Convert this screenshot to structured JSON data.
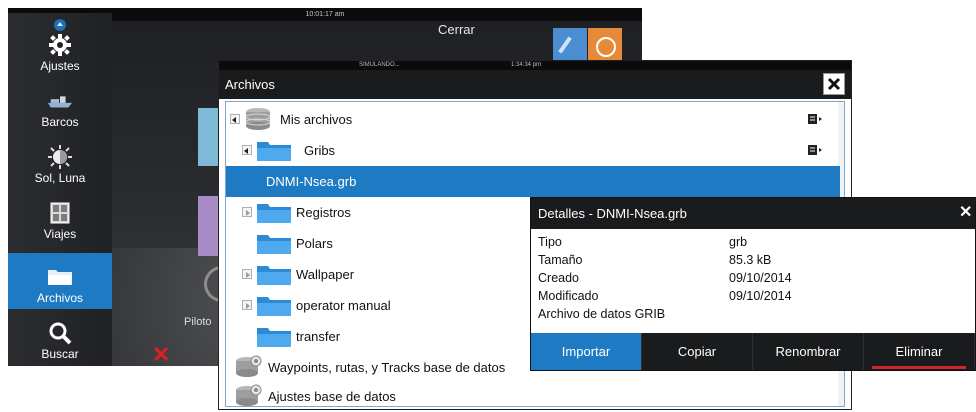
{
  "background": {
    "clock": "10:01:17 am",
    "close_label": "Cerrar",
    "pilot_label": "Piloto"
  },
  "sidebar": {
    "items": [
      {
        "label": "Ajustes",
        "icon": "gear-icon"
      },
      {
        "label": "Barcos",
        "icon": "boats-icon"
      },
      {
        "label": "Sol, Luna",
        "icon": "sun-moon-icon"
      },
      {
        "label": "Viajes",
        "icon": "trips-icon"
      },
      {
        "label": "Archivos",
        "icon": "folder-icon",
        "active": true
      },
      {
        "label": "Buscar",
        "icon": "search-icon"
      }
    ]
  },
  "files_dialog": {
    "status_left": "SIMULANDO...",
    "status_time": "1:34:34 pm",
    "title": "Archivos",
    "rows": [
      {
        "label": "Mis archivos",
        "type": "database",
        "expander": "open",
        "menu": true
      },
      {
        "label": "Gribs",
        "type": "folder",
        "expander": "open",
        "menu": true
      },
      {
        "label": "DNMI-Nsea.grb",
        "type": "file",
        "selected": true
      },
      {
        "label": "Registros",
        "type": "folder",
        "expander": "closed"
      },
      {
        "label": "Polars",
        "type": "folder"
      },
      {
        "label": "Wallpaper",
        "type": "folder",
        "expander": "closed"
      },
      {
        "label": "operator manual",
        "type": "folder",
        "expander": "closed"
      },
      {
        "label": "transfer",
        "type": "folder"
      },
      {
        "label": "Waypoints, rutas, y Tracks base de datos",
        "type": "database-gear"
      },
      {
        "label": "Ajustes base de datos",
        "type": "database-gear"
      }
    ]
  },
  "details": {
    "title": "Detalles - DNMI-Nsea.grb",
    "fields": [
      {
        "label": "Tipo",
        "value": "grb"
      },
      {
        "label": "Tamaño",
        "value": "85.3 kB"
      },
      {
        "label": "Creado",
        "value": "09/10/2014"
      },
      {
        "label": "Modificado",
        "value": "09/10/2014"
      },
      {
        "label": "Archivo de datos GRIB",
        "value": ""
      }
    ],
    "buttons": [
      "Importar",
      "Copiar",
      "Renombrar",
      "Eliminar"
    ]
  },
  "colors": {
    "accent": "#1e7bc3",
    "danger": "#d0242a",
    "titlebar": "#1a1b1d"
  }
}
